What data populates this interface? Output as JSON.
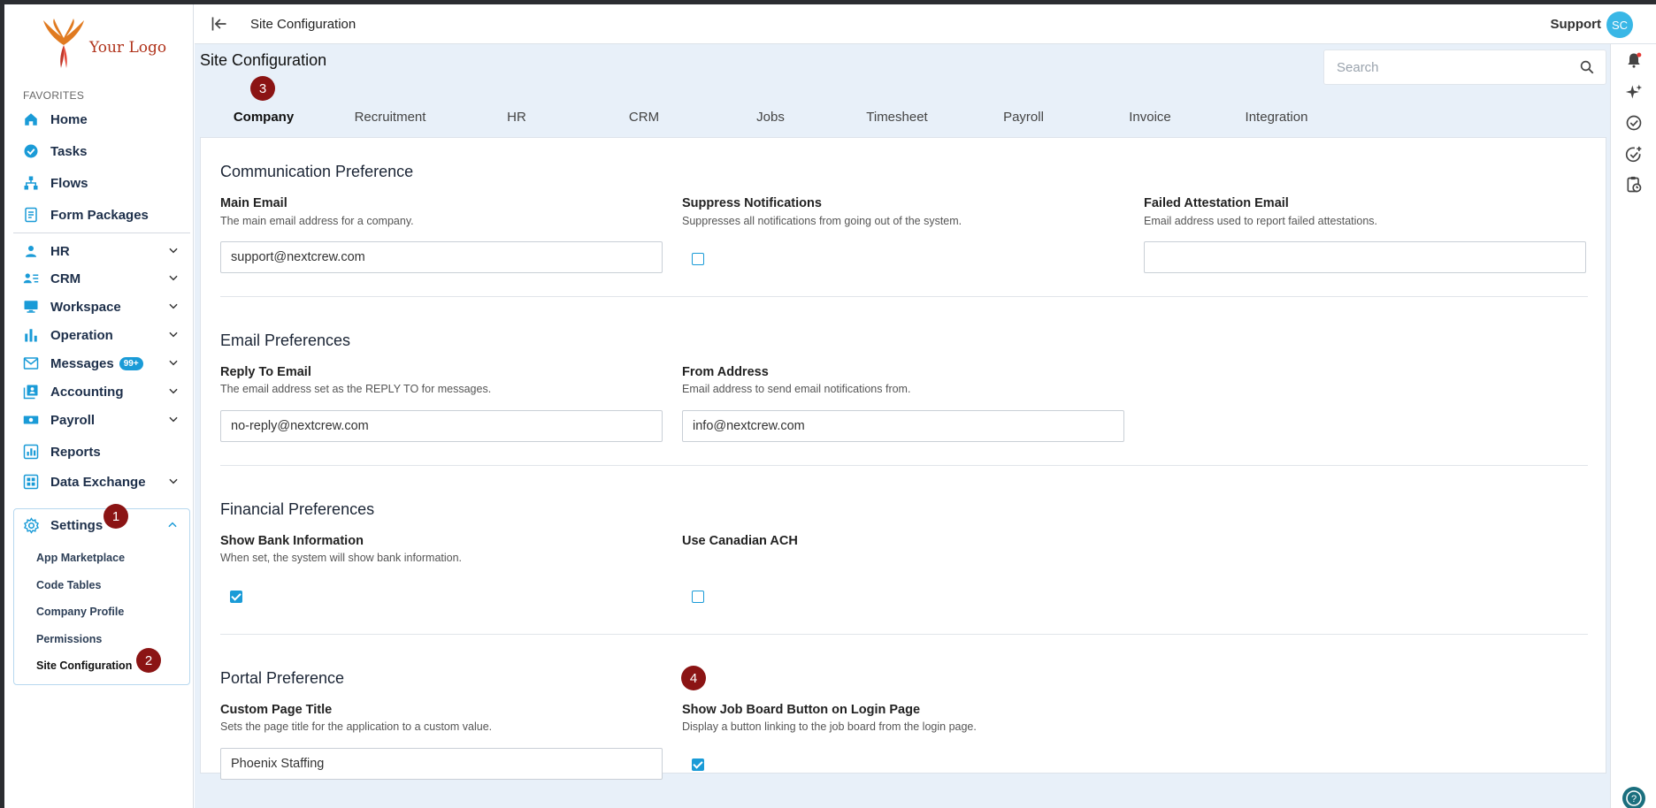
{
  "sidebar": {
    "logo_text": "Your Logo",
    "favorites_label": "FAVORITES",
    "items": [
      {
        "label": "Home",
        "icon": "home-icon"
      },
      {
        "label": "Tasks",
        "icon": "check-circle-icon"
      },
      {
        "label": "Flows",
        "icon": "flow-icon"
      },
      {
        "label": "Form Packages",
        "icon": "form-icon"
      },
      {
        "label": "HR",
        "icon": "person-icon"
      },
      {
        "label": "CRM",
        "icon": "contacts-icon"
      },
      {
        "label": "Workspace",
        "icon": "monitor-icon"
      },
      {
        "label": "Operation",
        "icon": "bar-chart-icon"
      },
      {
        "label": "Messages",
        "icon": "mail-icon",
        "badge": "99+"
      },
      {
        "label": "Accounting",
        "icon": "ledger-icon"
      },
      {
        "label": "Payroll",
        "icon": "cash-icon"
      },
      {
        "label": "Reports",
        "icon": "report-icon"
      },
      {
        "label": "Data Exchange",
        "icon": "grid-icon"
      }
    ],
    "settings": {
      "label": "Settings",
      "marker": "1",
      "children": [
        {
          "label": "App Marketplace"
        },
        {
          "label": "Code Tables"
        },
        {
          "label": "Company Profile"
        },
        {
          "label": "Permissions"
        },
        {
          "label": "Site Configuration",
          "active": true,
          "marker": "2"
        }
      ]
    }
  },
  "topbar": {
    "title": "Site Configuration",
    "user_label": "Support",
    "avatar_initials": "SC"
  },
  "page": {
    "title": "Site Configuration",
    "search_placeholder": "Search",
    "tab_marker": "3",
    "tabs": [
      "Company",
      "Recruitment",
      "HR",
      "CRM",
      "Jobs",
      "Timesheet",
      "Payroll",
      "Invoice",
      "Integration"
    ],
    "active_tab": "Company"
  },
  "sections": {
    "communication": {
      "title": "Communication Preference",
      "main_email": {
        "label": "Main Email",
        "desc": "The main email address for a company.",
        "value": "support@nextcrew.com"
      },
      "suppress": {
        "label": "Suppress Notifications",
        "desc": "Suppresses all notifications from going out of the system.",
        "checked": false
      },
      "failed": {
        "label": "Failed Attestation Email",
        "desc": "Email address used to report failed attestations.",
        "value": ""
      }
    },
    "email": {
      "title": "Email Preferences",
      "reply_to": {
        "label": "Reply To Email",
        "desc": "The email address set as the REPLY TO for messages.",
        "value": "no-reply@nextcrew.com"
      },
      "from": {
        "label": "From Address",
        "desc": "Email address to send email notifications from.",
        "value": "info@nextcrew.com"
      }
    },
    "financial": {
      "title": "Financial Preferences",
      "bank": {
        "label": "Show Bank Information",
        "desc": "When set, the system will show bank information.",
        "checked": true
      },
      "ach": {
        "label": "Use Canadian ACH",
        "checked": false
      }
    },
    "portal": {
      "title": "Portal Preference",
      "marker": "4",
      "page_title": {
        "label": "Custom Page Title",
        "desc": "Sets the page title for the application to a custom value.",
        "value": "Phoenix Staffing"
      },
      "job_board": {
        "label": "Show Job Board Button on Login Page",
        "desc": "Display a button linking to the job board from the login page.",
        "checked": true
      }
    }
  },
  "colors": {
    "accent": "#1a9bd7",
    "marker": "#8b1414",
    "content_bg": "#e8f0f9"
  }
}
